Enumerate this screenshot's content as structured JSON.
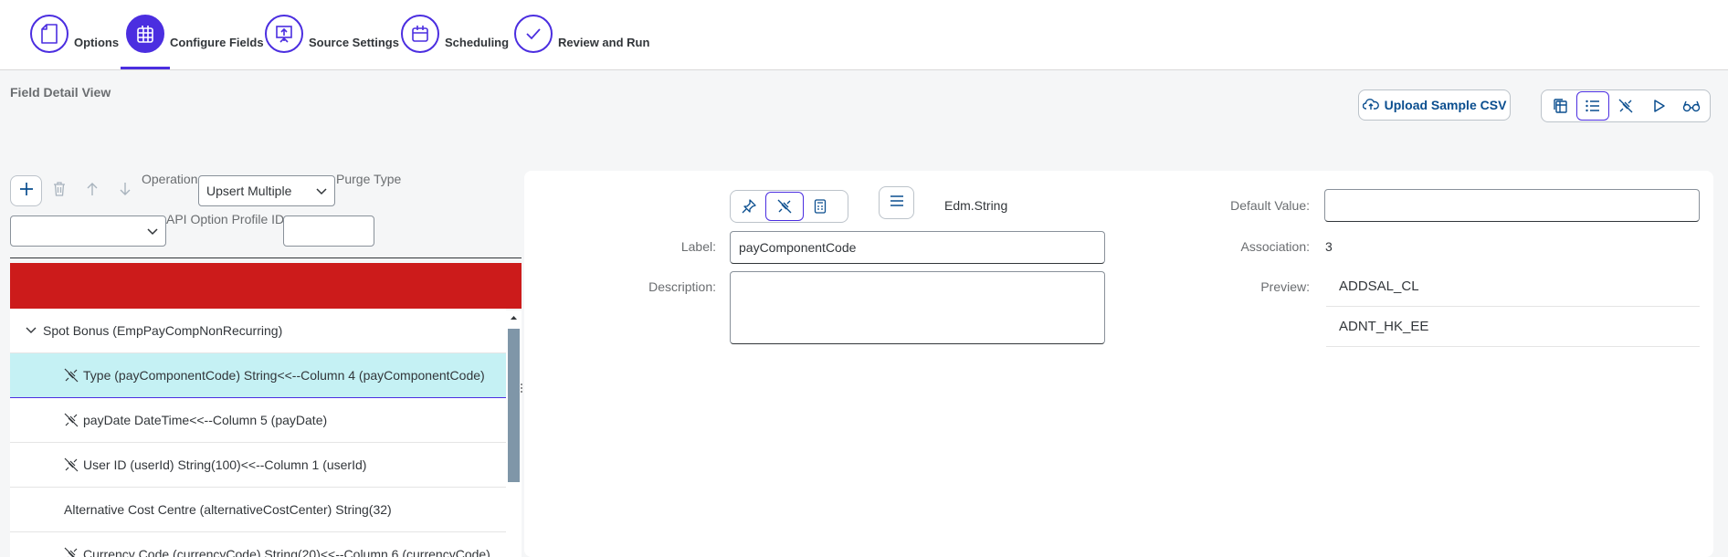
{
  "steps": [
    {
      "label": "Options",
      "icon": "document-icon"
    },
    {
      "label": "Configure Fields",
      "icon": "table-grid-icon"
    },
    {
      "label": "Source Settings",
      "icon": "upload-presentation-icon"
    },
    {
      "label": "Scheduling",
      "icon": "calendar-icon"
    },
    {
      "label": "Review and Run",
      "icon": "checkmark-icon"
    }
  ],
  "page": {
    "title": "Field Detail View"
  },
  "header_actions": {
    "upload_label": "Upload Sample CSV",
    "view_icons": [
      "copy-table-icon",
      "list-icon",
      "disconnect-icon",
      "play-icon",
      "glasses-icon"
    ]
  },
  "toolbar": {
    "operation_label": "Operation",
    "operation_value": "Upsert Multiple",
    "purge_type_label": "Purge Type",
    "purge_type_value": "",
    "api_option_label": "API Option Profile ID",
    "api_option_value": ""
  },
  "tree": {
    "group_label": "Spot Bonus (EmpPayCompNonRecurring)",
    "rows": [
      {
        "label": "Type (payComponentCode) String<<--Column 4 (payComponentCode)",
        "linked": true
      },
      {
        "label": "payDate DateTime<<--Column 5 (payDate)",
        "linked": true
      },
      {
        "label": "User ID (userId) String(100)<<--Column 1 (userId)",
        "linked": true
      },
      {
        "label": "Alternative Cost Centre (alternativeCostCenter) String(32)",
        "linked": false
      },
      {
        "label": "Currency Code (currencyCode) String(20)<<--Column 6 (currencyCode)",
        "linked": true
      }
    ]
  },
  "detail": {
    "type_text": "Edm.String",
    "label_caption": "Label:",
    "label_value": "payComponentCode",
    "description_caption": "Description:",
    "description_value": "",
    "default_caption": "Default Value:",
    "default_value": "",
    "association_caption": "Association:",
    "association_value": "3",
    "preview_caption": "Preview:",
    "preview_values": [
      "ADDSAL_CL",
      "ADNT_HK_EE"
    ]
  },
  "colors": {
    "accent": "#4b2ee0",
    "header_bar": "#cc1b1b",
    "selected_row": "#c5f1f4"
  }
}
